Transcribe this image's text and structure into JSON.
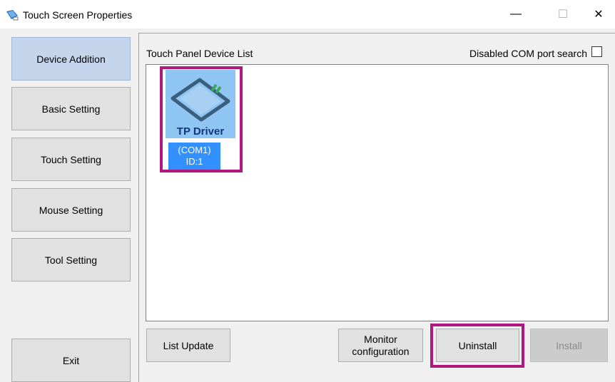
{
  "window": {
    "title": "Touch Screen Properties",
    "minimize_glyph": "—",
    "maximize_glyph": "☐",
    "close_glyph": "✕"
  },
  "sidebar": {
    "items": [
      {
        "label": "Device Addition",
        "active": true
      },
      {
        "label": "Basic Setting",
        "active": false
      },
      {
        "label": "Touch Setting",
        "active": false
      },
      {
        "label": "Mouse Setting",
        "active": false
      },
      {
        "label": "Tool Setting",
        "active": false
      }
    ],
    "exit_label": "Exit"
  },
  "main": {
    "list_title": "Touch Panel Device List",
    "disabled_com_search_label": "Disabled COM port search",
    "disabled_com_search_checked": false,
    "devices": [
      {
        "name": "TP Driver",
        "port": "(COM1)",
        "id_label": "ID:1",
        "selected": true
      }
    ],
    "buttons": {
      "list_update": "List Update",
      "monitor_config_line1": "Monitor",
      "monitor_config_line2": "configuration",
      "uninstall": "Uninstall",
      "install": "Install"
    }
  },
  "colors": {
    "highlight": "#b0187e",
    "selection": "#3390ff",
    "tile": "#8fc5f2",
    "active_tab": "#c5d6ec"
  }
}
